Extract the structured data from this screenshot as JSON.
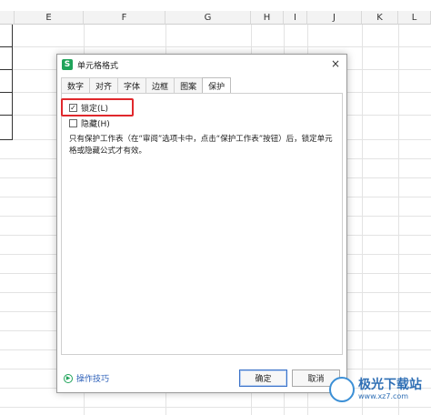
{
  "sheet": {
    "columns": [
      "E",
      "F",
      "G",
      "H",
      "I",
      "J",
      "K",
      "L"
    ]
  },
  "dialog": {
    "title": "单元格格式",
    "close_glyph": "×",
    "tabs": [
      "数字",
      "对齐",
      "字体",
      "边框",
      "图案",
      "保护"
    ],
    "active_tab": "保护",
    "lock_label": "锁定(L)",
    "lock_checked": true,
    "hide_label": "隐藏(H)",
    "hide_checked": false,
    "description": "只有保护工作表（在“审阅”选项卡中，点击“保护工作表”按钮）后，锁定单元格或隐藏公式才有效。",
    "tips_label": "操作技巧",
    "ok_label": "确定",
    "cancel_label": "取消"
  },
  "watermark": {
    "name": "极光下载站",
    "url": "www.xz7.com"
  },
  "colors": {
    "highlight": "#e0282c",
    "app_icon": "#1fa35a",
    "link": "#2b5fb8"
  }
}
